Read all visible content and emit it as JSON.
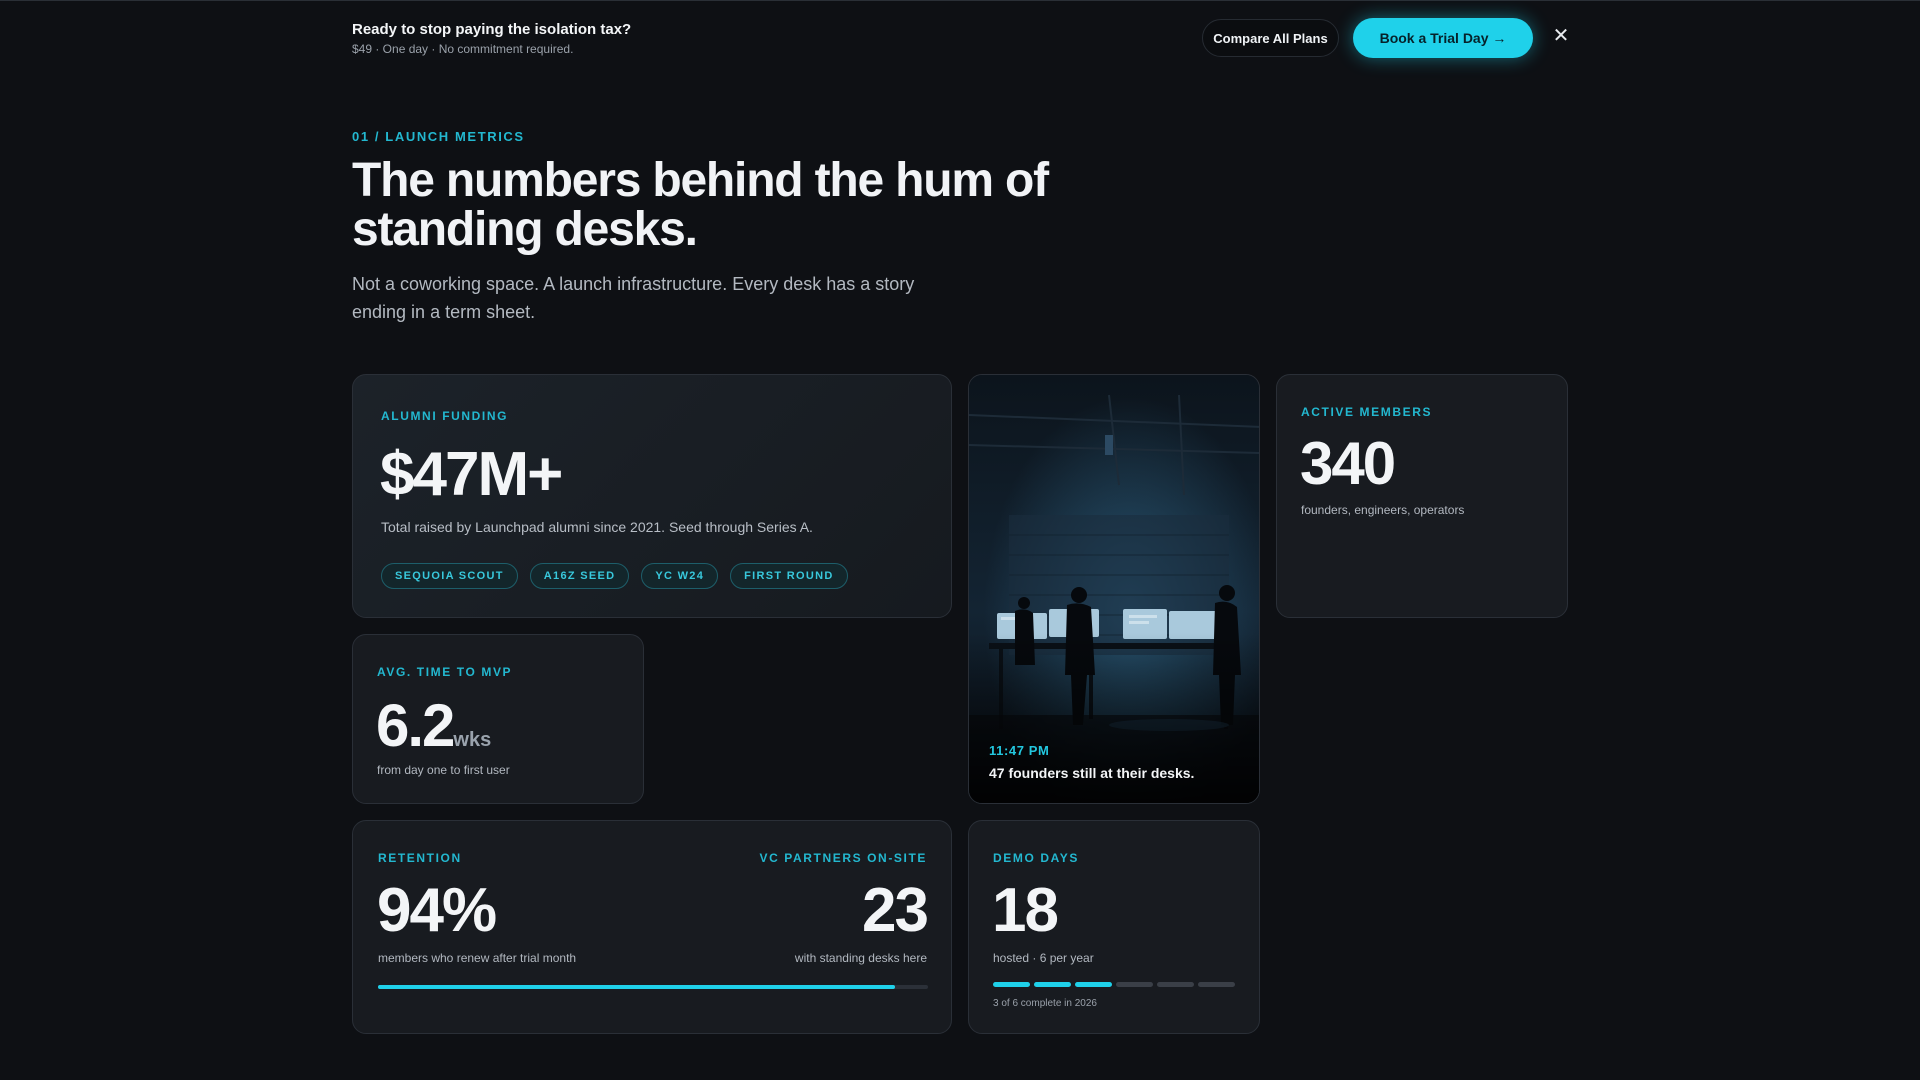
{
  "banner": {
    "title": "Ready to stop paying the isolation tax?",
    "subtitle": "$49 · One day · No commitment required.",
    "compare_label": "Compare All Plans",
    "trial_label": "Book a Trial Day →",
    "close_label": "✕"
  },
  "hero": {
    "eyebrow": "01 / LAUNCH METRICS",
    "headline": "The numbers behind the hum of standing desks.",
    "lede": "Not a coworking space. A launch infrastructure. Every desk has a story ending in a term sheet."
  },
  "funding": {
    "label": "ALUMNI FUNDING",
    "value": "$47M+",
    "desc": "Total raised by Launchpad alumni since 2021. Seed through Series A.",
    "tags": [
      "SEQUOIA SCOUT",
      "A16Z SEED",
      "YC W24",
      "FIRST ROUND"
    ]
  },
  "photo": {
    "time": "11:47 PM",
    "caption": "47 founders still at their desks."
  },
  "members": {
    "label": "ACTIVE MEMBERS",
    "value": "340",
    "desc": "founders, engineers, operators"
  },
  "mvp": {
    "label": "AVG. TIME TO MVP",
    "value": "6.2",
    "unit": "wks",
    "desc": "from day one to first user"
  },
  "retention": {
    "label": "RETENTION",
    "value": "94%",
    "desc": "members who renew after trial month",
    "progress": 0.94,
    "vc_label": "VC PARTNERS ON-SITE",
    "vc_value": "23",
    "vc_desc": "with standing desks here"
  },
  "demo": {
    "label": "DEMO DAYS",
    "value": "18",
    "desc": "hosted · 6 per year",
    "completed": 3,
    "total": 6,
    "progress_text": "3 of 6 complete in 2026"
  },
  "colors": {
    "accent": "#1fd1ea",
    "label": "#23b8d0",
    "background": "#0e1014",
    "card": "#181b20"
  }
}
